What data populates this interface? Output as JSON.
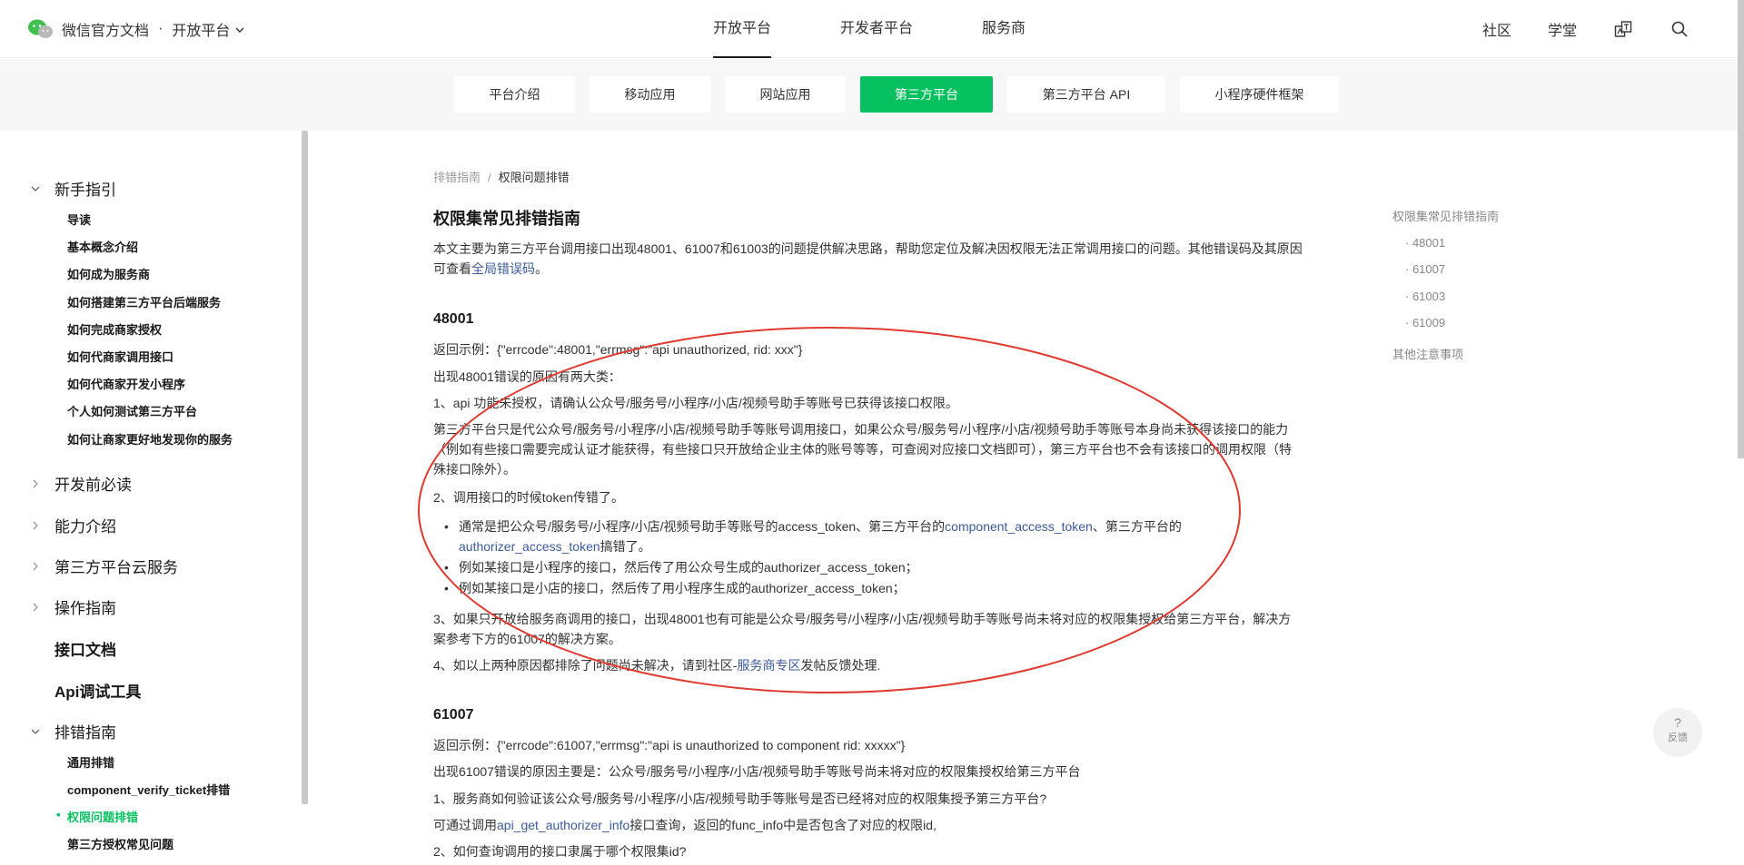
{
  "header": {
    "logo_text": "微信官方文档",
    "dot": "·",
    "platform": "开放平台",
    "nav": [
      "开放平台",
      "开发者平台",
      "服务商"
    ],
    "right_links": [
      "社区",
      "学堂"
    ]
  },
  "tabs": [
    "平台介绍",
    "移动应用",
    "网站应用",
    "第三方平台",
    "第三方平台 API",
    "小程序硬件框架"
  ],
  "sidebar": {
    "sections": {
      "guide": "新手指引",
      "before_dev": "开发前必读",
      "abilities": "能力介绍",
      "cloud": "第三方平台云服务",
      "ops": "操作指南",
      "api_docs": "接口文档",
      "api_tool": "Api调试工具",
      "troubleshoot": "排错指南"
    },
    "guide_items": [
      "导读",
      "基本概念介绍",
      "如何成为服务商",
      "如何搭建第三方平台后端服务",
      "如何完成商家授权",
      "如何代商家调用接口",
      "如何代商家开发小程序",
      "个人如何测试第三方平台",
      "如何让商家更好地发现你的服务"
    ],
    "troubleshoot_items": [
      "通用排错",
      "component_verify_ticket排错",
      "权限问题排错",
      "第三方授权常见问题"
    ]
  },
  "breadcrumb": {
    "parent": "排错指南",
    "sep": "/",
    "current": "权限问题排错"
  },
  "content": {
    "title": "权限集常见排错指南",
    "intro_1": "本文主要为第三方平台调用接口出现48001、61007和61003的问题提供解决思路，帮助您定位及解决因权限无法正常调用接口的问题。其他错误码及其原因可查看",
    "intro_link": "全局错误码",
    "intro_2": "。",
    "s1_title": "48001",
    "s1_example": "返回示例：{\"errcode\":48001,\"errmsg\":\"api unauthorized, rid: xxx\"}",
    "s1_reasons": "出现48001错误的原因有两大类：",
    "s1_r1": "1、api 功能未授权，请确认公众号/服务号/小程序/小店/视频号助手等账号已获得该接口权限。",
    "s1_r1_detail": "第三方平台只是代公众号/服务号/小程序/小店/视频号助手等账号调用接口，如果公众号/服务号/小程序/小店/视频号助手等账号本身尚未获得该接口的能力（例如有些接口需要完成认证才能获得，有些接口只开放给企业主体的账号等等，可查阅对应接口文档即可），第三方平台也不会有该接口的调用权限（特殊接口除外）。",
    "s1_r2": "2、调用接口的时候token传错了。",
    "s1_b1_a": "通常是把公众号/服务号/小程序/小店/视频号助手等账号的access_token、第三方平台的",
    "s1_b1_link1": "component_access_token",
    "s1_b1_b": "、第三方平台的",
    "s1_b1_link2": "authorizer_access_token",
    "s1_b1_c": "搞错了。",
    "s1_b2": "例如某接口是小程序的接口，然后传了用公众号生成的authorizer_access_token；",
    "s1_b3": "例如某接口是小店的接口，然后传了用小程序生成的authorizer_access_token；",
    "s1_r3": "3、如果只开放给服务商调用的接口，出现48001也有可能是公众号/服务号/小程序/小店/视频号助手等账号尚未将对应的权限集授权给第三方平台，解决方案参考下方的61007的解决方案。",
    "s1_r4_a": "4、如以上两种原因都排除了问题尚未解决，请到社区-",
    "s1_r4_link": "服务商专区",
    "s1_r4_b": "发帖反馈处理.",
    "s2_title": "61007",
    "s2_example": "返回示例：{\"errcode\":61007,\"errmsg\":\"api is unauthorized to component rid: xxxxx\"}",
    "s2_reason": "出现61007错误的原因主要是：公众号/服务号/小程序/小店/视频号助手等账号尚未将对应的权限集授权给第三方平台",
    "s2_q1": "1、服务商如何验证该公众号/服务号/小程序/小店/视频号助手等账号是否已经将对应的权限集授予第三方平台?",
    "s2_a1_a": "可通过调用",
    "s2_a1_link": "api_get_authorizer_info",
    "s2_a1_b": "接口查询，返回的func_info中是否包含了对应的权限id,",
    "s2_q2": "2、如何查询调用的接口隶属于哪个权限集id?"
  },
  "toc": [
    "权限集常见排错指南",
    "48001",
    "61007",
    "61003",
    "61009",
    "其他注意事项"
  ],
  "feedback": {
    "icon": "?",
    "label": "反馈"
  },
  "colors": {
    "accent": "#07c160",
    "link": "#3b5b9d",
    "annotation": "#e03a2f"
  }
}
